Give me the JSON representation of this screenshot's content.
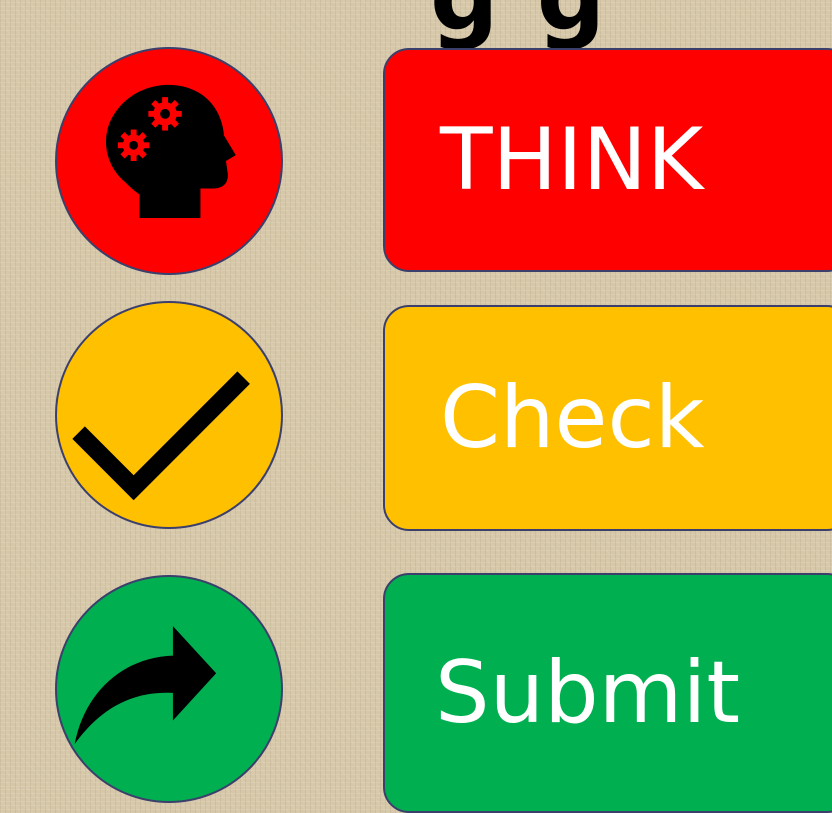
{
  "steps": [
    {
      "id": "think",
      "label": "THINK",
      "color": "#ff0000",
      "icon": "head-gears-icon"
    },
    {
      "id": "check",
      "label": "Check",
      "color": "#ffc000",
      "icon": "checkmark-icon"
    },
    {
      "id": "submit",
      "label": "Submit",
      "color": "#00b050",
      "icon": "curved-arrow-icon"
    }
  ]
}
